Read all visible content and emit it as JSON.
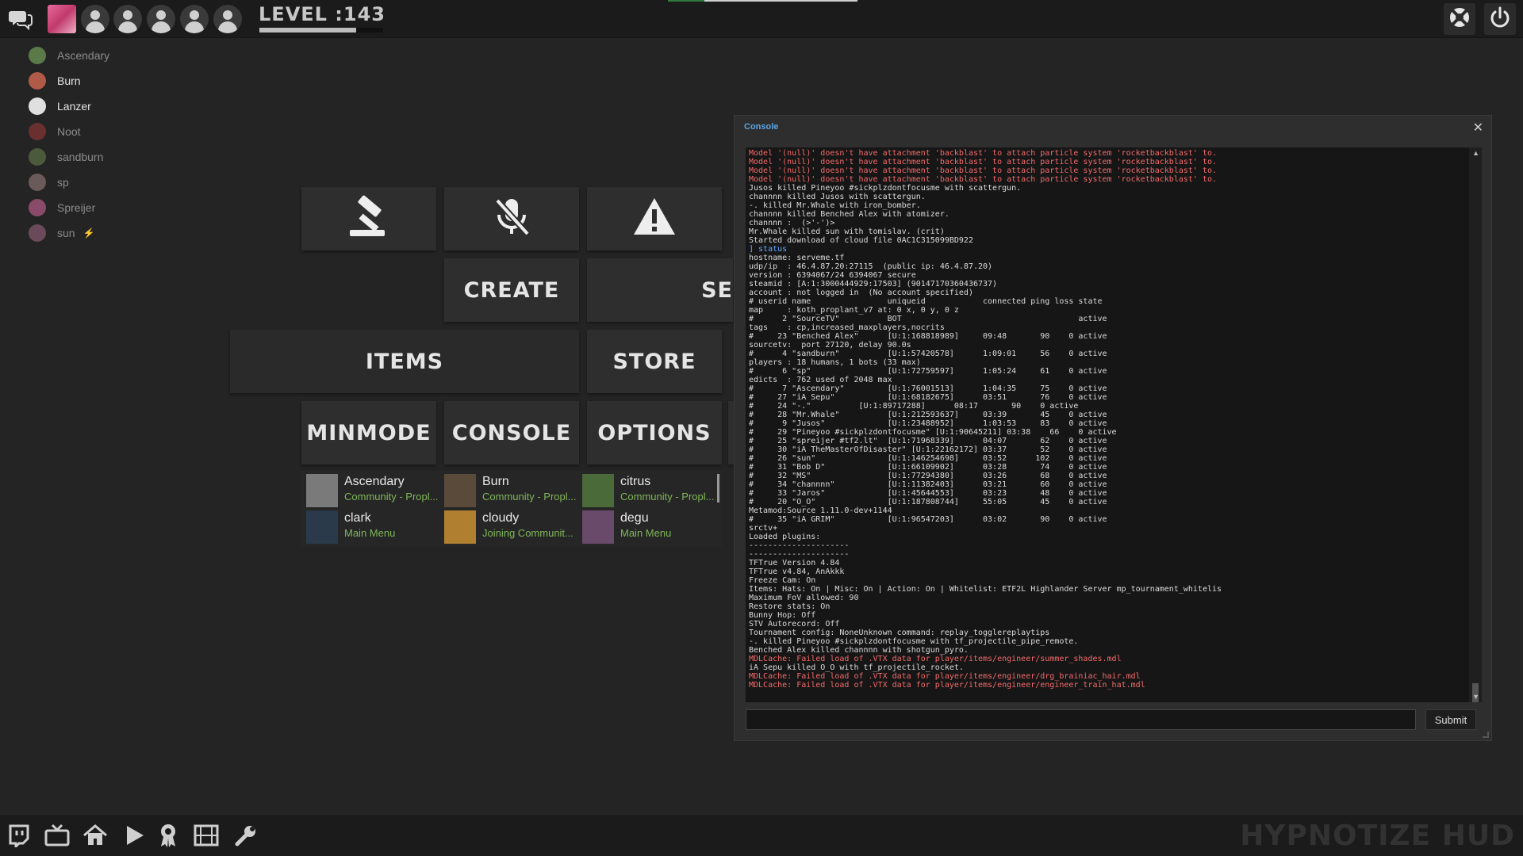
{
  "top_bar": {
    "level_label": "LEVEL :143",
    "level_progress": 0.78,
    "party_slots": [
      "empty",
      "empty",
      "empty",
      "empty",
      "empty"
    ]
  },
  "friends_list": [
    {
      "name": "Ascendary",
      "online": false
    },
    {
      "name": "Burn",
      "online": true
    },
    {
      "name": "Lanzer",
      "online": true
    },
    {
      "name": "Noot",
      "online": false
    },
    {
      "name": "sandburn",
      "online": false
    },
    {
      "name": "sp",
      "online": false
    },
    {
      "name": "Spreijer",
      "online": false
    },
    {
      "name": "sun",
      "online": false
    }
  ],
  "menu": {
    "create": "CREATE",
    "servers_partial": "SE",
    "items": "ITEMS",
    "store": "STORE",
    "minmode": "MINMODE",
    "console": "CONSOLE",
    "options": "OPTIONS"
  },
  "party_friends": [
    {
      "name": "Ascendary",
      "status": "Community - Propl..."
    },
    {
      "name": "Burn",
      "status": "Community - Propl..."
    },
    {
      "name": "citrus",
      "status": "Community - Propl..."
    },
    {
      "name": "clark",
      "status": "Main Menu"
    },
    {
      "name": "cloudy",
      "status": "Joining Communit..."
    },
    {
      "name": "degu",
      "status": "Main Menu"
    }
  ],
  "console": {
    "title": "Console",
    "submit_label": "Submit",
    "input_value": "",
    "lines": [
      {
        "t": "Model '(null)' doesn't have attachment 'backblast' to attach particle system 'rocketbackblast' to.",
        "k": "err"
      },
      {
        "t": "Model '(null)' doesn't have attachment 'backblast' to attach particle system 'rocketbackblast' to.",
        "k": "err"
      },
      {
        "t": "Model '(null)' doesn't have attachment 'backblast' to attach particle system 'rocketbackblast' to.",
        "k": "err"
      },
      {
        "t": "Model '(null)' doesn't have attachment 'backblast' to attach particle system 'rocketbackblast' to.",
        "k": "err"
      },
      {
        "t": "Jusos killed Pineyoo #sickplzdontfocusme with scattergun.",
        "k": ""
      },
      {
        "t": "channnn killed Jusos with scattergun.",
        "k": ""
      },
      {
        "t": "-. killed Mr.Whale with iron_bomber.",
        "k": ""
      },
      {
        "t": "channnn killed Benched Alex with atomizer.",
        "k": ""
      },
      {
        "t": "channnn :  (>'-')>",
        "k": ""
      },
      {
        "t": "Mr.Whale killed sun with tomislav. (crit)",
        "k": ""
      },
      {
        "t": "Started download of cloud file 0AC1C315099BD922",
        "k": ""
      },
      {
        "t": "] status",
        "k": "cmd"
      },
      {
        "t": "hostname: serveme.tf",
        "k": ""
      },
      {
        "t": "udp/ip  : 46.4.87.20:27115  (public ip: 46.4.87.20)",
        "k": ""
      },
      {
        "t": "version : 6394067/24 6394067 secure",
        "k": ""
      },
      {
        "t": "steamid : [A:1:3000444929:17503] (90147170360436737)",
        "k": ""
      },
      {
        "t": "account : not logged in  (No account specified)",
        "k": ""
      },
      {
        "t": "# userid name                uniqueid            connected ping loss state",
        "k": ""
      },
      {
        "t": "map     : koth_proplant_v7 at: 0 x, 0 y, 0 z",
        "k": ""
      },
      {
        "t": "#      2 \"SourceTV\"          BOT                                     active",
        "k": ""
      },
      {
        "t": "tags    : cp,increased_maxplayers,nocrits",
        "k": ""
      },
      {
        "t": "#     23 \"Benched Alex\"      [U:1:168818989]     09:48       90    0 active",
        "k": ""
      },
      {
        "t": "sourcetv:  port 27120, delay 90.0s",
        "k": ""
      },
      {
        "t": "#      4 \"sandburn\"          [U:1:57420578]      1:09:01     56    0 active",
        "k": ""
      },
      {
        "t": "players : 18 humans, 1 bots (33 max)",
        "k": ""
      },
      {
        "t": "#      6 \"sp\"                [U:1:72759597]      1:05:24     61    0 active",
        "k": ""
      },
      {
        "t": "edicts  : 762 used of 2048 max",
        "k": ""
      },
      {
        "t": "#      7 \"Ascendary\"         [U:1:76001513]      1:04:35     75    0 active",
        "k": ""
      },
      {
        "t": "#     27 \"iA Sepu\"           [U:1:68182675]      03:51       76    0 active",
        "k": ""
      },
      {
        "t": "#     24 \"-.\"          [U:1:89717288]      08:17       90    0 active",
        "k": ""
      },
      {
        "t": "#     28 \"Mr.Whale\"          [U:1:212593637]     03:39       45    0 active",
        "k": ""
      },
      {
        "t": "#      9 \"Jusos\"             [U:1:23488952]      1:03:53     83    0 active",
        "k": ""
      },
      {
        "t": "#     29 \"Pineyoo #sickplzdontfocusme\" [U:1:90645211] 03:38    66    0 active",
        "k": ""
      },
      {
        "t": "#     25 \"spreijer #tf2.lt\"  [U:1:71968339]      04:07       62    0 active",
        "k": ""
      },
      {
        "t": "#     30 \"iA TheMasterOfDisaster\" [U:1:22162172] 03:37       52    0 active",
        "k": ""
      },
      {
        "t": "#     26 \"sun\"               [U:1:146254698]     03:52      102    0 active",
        "k": ""
      },
      {
        "t": "#     31 \"Bob D\"             [U:1:66109902]      03:28       74    0 active",
        "k": ""
      },
      {
        "t": "#     32 \"MS\"                [U:1:77294380]      03:26       68    0 active",
        "k": ""
      },
      {
        "t": "#     34 \"channnn\"           [U:1:11382403]      03:21       60    0 active",
        "k": ""
      },
      {
        "t": "#     33 \"Jaros\"             [U:1:45644553]      03:23       48    0 active",
        "k": ""
      },
      {
        "t": "#     20 \"O_O\"               [U:1:187808744]     55:05       45    0 active",
        "k": ""
      },
      {
        "t": "Metamod:Source 1.11.0-dev+1144",
        "k": ""
      },
      {
        "t": "#     35 \"iA GRIM\"           [U:1:96547203]      03:02       90    0 active",
        "k": ""
      },
      {
        "t": "srctv+",
        "k": ""
      },
      {
        "t": "Loaded plugins:",
        "k": ""
      },
      {
        "t": "---------------------",
        "k": ""
      },
      {
        "t": "---------------------",
        "k": ""
      },
      {
        "t": "TFTrue Version 4.84",
        "k": ""
      },
      {
        "t": "TFTrue v4.84, AnAkkk",
        "k": ""
      },
      {
        "t": "Freeze Cam: On",
        "k": ""
      },
      {
        "t": "Items: Hats: On | Misc: On | Action: On | Whitelist: ETF2L Highlander Server mp_tournament_whitelis",
        "k": ""
      },
      {
        "t": "Maximum FoV allowed: 90",
        "k": ""
      },
      {
        "t": "Restore stats: On",
        "k": ""
      },
      {
        "t": "Bunny Hop: Off",
        "k": ""
      },
      {
        "t": "STV Autorecord: Off",
        "k": ""
      },
      {
        "t": "Tournament config: NoneUnknown command: replay_togglereplaytips",
        "k": ""
      },
      {
        "t": "-. killed Pineyoo #sickplzdontfocusme with tf_projectile_pipe_remote.",
        "k": ""
      },
      {
        "t": "Benched Alex killed channnn with shotgun_pyro.",
        "k": ""
      },
      {
        "t": "MDLCache: Failed load of .VTX data for player/items/engineer/summer_shades.mdl",
        "k": "err"
      },
      {
        "t": "iA Sepu killed O_O with tf_projectile_rocket.",
        "k": ""
      },
      {
        "t": "MDLCache: Failed load of .VTX data for player/items/engineer/drg_brainiac_hair.mdl",
        "k": "err"
      },
      {
        "t": "MDLCache: Failed load of .VTX data for player/items/engineer/engineer_train_hat.mdl",
        "k": "err"
      }
    ]
  },
  "bottom_bar": {
    "brand": "HYPNOTIZE HUD",
    "icons": [
      "twitch-icon",
      "tv-icon",
      "home-icon",
      "play-icon",
      "achievement-icon",
      "film-icon",
      "wrench-icon"
    ]
  },
  "colors": {
    "background": "#242424",
    "bar": "#1b1b1b",
    "tile": "#2e2e2e",
    "status_green": "#7fb65a",
    "console_error": "#f36a6a",
    "console_title": "#5aa5e0"
  }
}
